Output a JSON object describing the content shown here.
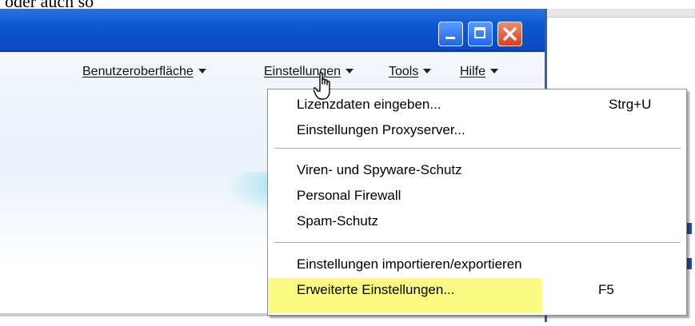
{
  "caption": "oder auch so",
  "window": {
    "controls": {
      "minimize_icon": "minimize-icon",
      "maximize_icon": "maximize-icon",
      "close_icon": "close-icon"
    }
  },
  "menubar": {
    "items": [
      {
        "label": "Benutzeroberfläche"
      },
      {
        "label": "Einstellungen"
      },
      {
        "label": "Tools"
      },
      {
        "label": "Hilfe"
      }
    ]
  },
  "dropdown": {
    "groups": [
      [
        {
          "label": "Lizenzdaten eingeben...",
          "shortcut": "Strg+U"
        },
        {
          "label": "Einstellungen Proxyserver...",
          "shortcut": ""
        }
      ],
      [
        {
          "label": "Viren- und Spyware-Schutz",
          "shortcut": ""
        },
        {
          "label": "Personal Firewall",
          "shortcut": ""
        },
        {
          "label": "Spam-Schutz",
          "shortcut": ""
        }
      ],
      [
        {
          "label": "Einstellungen importieren/exportieren",
          "shortcut": ""
        },
        {
          "label": "Erweiterte Einstellungen...",
          "shortcut": "F5"
        }
      ]
    ]
  },
  "colors": {
    "titlebar": "#0b4fc6",
    "highlight": "#fafa6e",
    "close_button": "#d9401c"
  }
}
